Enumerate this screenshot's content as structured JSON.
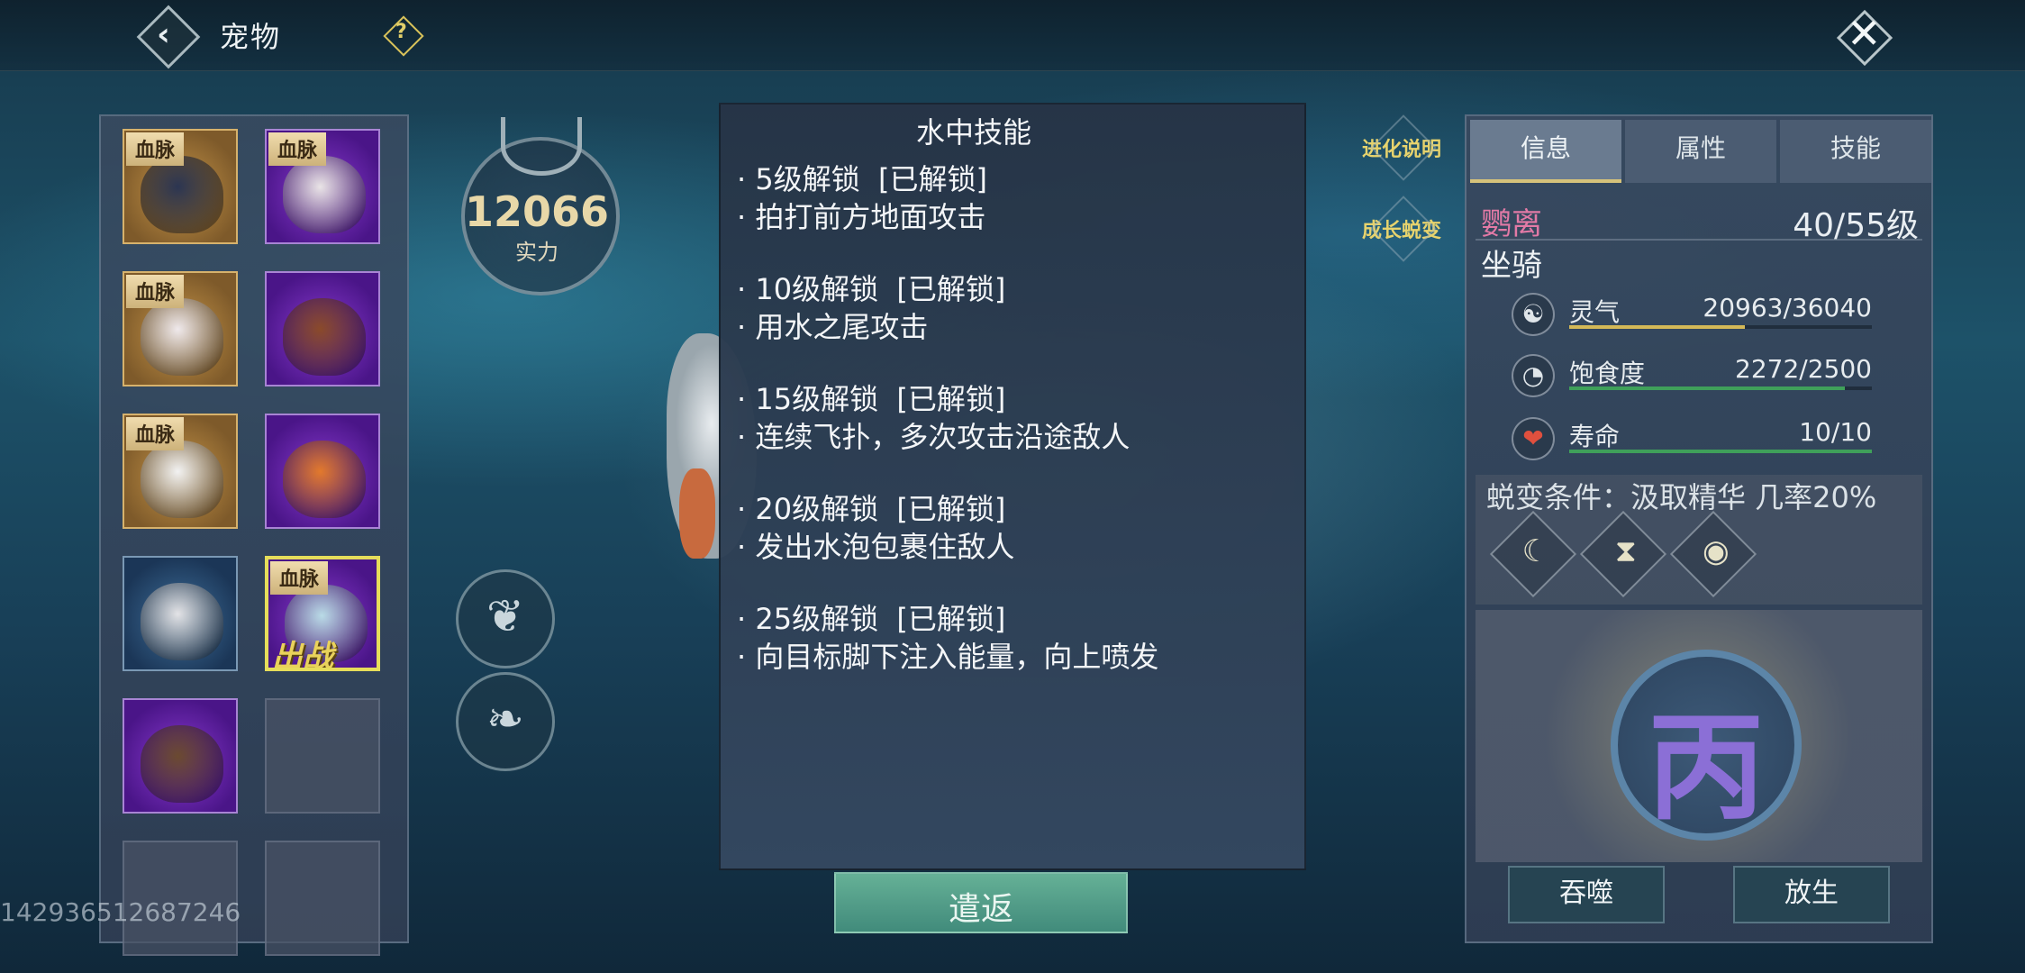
{
  "header": {
    "title": "宠物",
    "help_symbol": "?"
  },
  "uid": "142936512687246",
  "pets": [
    {
      "badge": "血脉",
      "tier": "gold",
      "art": "#2b3552"
    },
    {
      "badge": "血脉",
      "tier": "purple",
      "art": "#e9e4e6"
    },
    {
      "badge": "血脉",
      "tier": "gold",
      "art": "#efe9ec"
    },
    {
      "badge": "",
      "tier": "purple",
      "art": "#8a4a2a"
    },
    {
      "badge": "血脉",
      "tier": "gold",
      "art": "#f2f2f2"
    },
    {
      "badge": "",
      "tier": "purple",
      "art": "#e2792c"
    },
    {
      "badge": "",
      "tier": "blue",
      "art": "#e3e3e6"
    },
    {
      "badge": "血脉",
      "tier": "purple",
      "art": "#b9dbe6",
      "selected": true,
      "status": "出战"
    },
    {
      "badge": "",
      "tier": "purple",
      "art": "#6b4a30"
    },
    {
      "badge": "",
      "tier": "empty"
    },
    {
      "badge": "",
      "tier": "empty"
    },
    {
      "badge": "",
      "tier": "empty"
    }
  ],
  "power": {
    "value": "12066",
    "label": "实力"
  },
  "tooltip": {
    "title": "水中技能",
    "lines": [
      "· 5级解锁  [已解锁]",
      "· 拍打前方地面攻击",
      "· 10级解锁  [已解锁]",
      "· 用水之尾攻击",
      "· 15级解锁  [已解锁]",
      "· 连续飞扑，多次攻击沿途敌人",
      "· 20级解锁  [已解锁]",
      "· 发出水泡包裹住敌人",
      "· 25级解锁  [已解锁]",
      "· 向目标脚下注入能量，向上喷发"
    ]
  },
  "recall_label": "遣返",
  "side_links": {
    "evolution": "进化说明",
    "growth": "成长蜕变"
  },
  "info": {
    "tabs": [
      "信息",
      "属性",
      "技能"
    ],
    "active_tab": 0,
    "name": "鹦离",
    "level": "40/55级",
    "type": "坐骑",
    "stats": [
      {
        "label": "灵气",
        "value": "20963/36040",
        "fraction": 0.58,
        "color": "#d4b957",
        "icon": "spirit-icon"
      },
      {
        "label": "饱食度",
        "value": "2272/2500",
        "fraction": 0.91,
        "color": "#3fa05a",
        "icon": "stomach-icon"
      },
      {
        "label": "寿命",
        "value": "10/10",
        "fraction": 1.0,
        "color": "#3fa05a",
        "icon": "heart-icon"
      }
    ],
    "evolution_condition": "蜕变条件：汲取精华 几率20%",
    "evolution_icons": [
      "moon-icon",
      "hourglass-icon",
      "eye-icon"
    ],
    "emblem_char": "丙",
    "buttons": {
      "devour": "吞噬",
      "release": "放生"
    }
  }
}
